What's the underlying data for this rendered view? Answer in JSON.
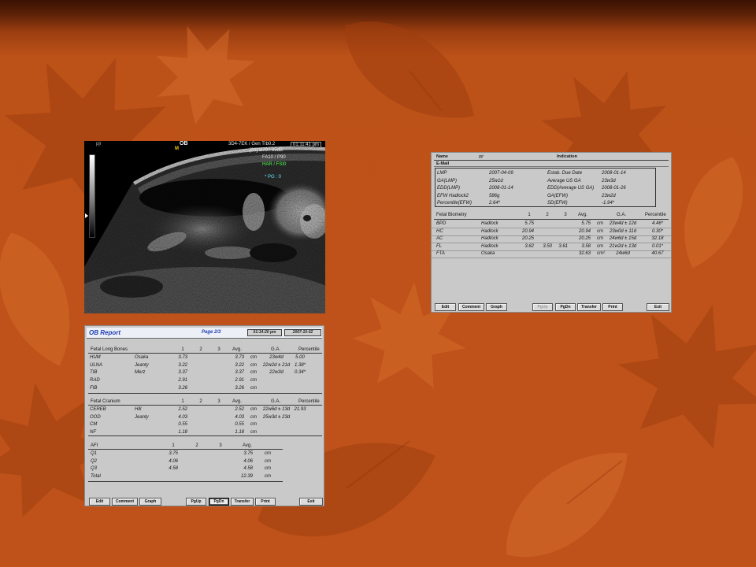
{
  "colors": {
    "slide_background": "#c0531a",
    "report_panel": "#c9c9c9",
    "report_title": "#1f3fb0",
    "harmonic_text": "#4cff4c",
    "pg_text": "#66e6ff",
    "marker": "#f0d000"
  },
  "ultrasound": {
    "patient": "pjr",
    "mode": "OB",
    "marker": "M",
    "probe": "3D4-7EK / Gen TIb0.2",
    "time": "01:11:41 pm",
    "gain": "[20] G70 / 95dB",
    "focus": "FA10 / P90",
    "harmonic": "HAR / FSI0",
    "pg": "* PG : 0"
  },
  "report1": {
    "name_label": "Name",
    "name_value": "pjr",
    "indication_label": "Indication",
    "email_label": "E-Mail",
    "summary": [
      {
        "label1": "LMP",
        "value1": "2007-04-09",
        "label2": "Estab. Due Date",
        "value2": "2008-01-14"
      },
      {
        "label1": "GA(LMP)",
        "value1": "25w1d",
        "label2": "Average US GA",
        "value2": "23w3d"
      },
      {
        "label1": "EDD(LMP)",
        "value1": "2008-01-14",
        "label2": "EDD(Average US GA)",
        "value2": "2008-01-26"
      },
      {
        "label1": "EFW Hadlock2",
        "value1": "586g",
        "label2": "GA(EFW)",
        "value2": "23w2d"
      },
      {
        "label1": "Percentile(EFW)",
        "value1": "2.64*",
        "label2": "SD(EFW)",
        "value2": "-1.94*"
      }
    ],
    "biometry": {
      "title": "Fetal Biometry",
      "col1": "1",
      "col2": "2",
      "col3": "3",
      "avg": "Avg.",
      "ga": "G.A.",
      "percentile": "Percentile",
      "rows": [
        {
          "name": "BPD",
          "method": "Hadlock",
          "m1": "5.75",
          "avg": "5.75",
          "unit": "cm",
          "ga": "23w4d ± 12d",
          "pct": "4.46*"
        },
        {
          "name": "HC",
          "method": "Hadlock",
          "m1": "20.94",
          "avg": "20.94",
          "unit": "cm",
          "ga": "23w0d ± 11d",
          "pct": "0.30*"
        },
        {
          "name": "AC",
          "method": "Hadlock",
          "m1": "20.25",
          "avg": "20.25",
          "unit": "cm",
          "ga": "24w6d ± 15d",
          "pct": "32.18"
        },
        {
          "name": "FL",
          "method": "Hadlock",
          "m1": "3.62",
          "m2": "3.50",
          "m3": "3.61",
          "avg": "3.58",
          "unit": "cm",
          "ga": "21w2d ± 13d",
          "pct": "0.01*"
        },
        {
          "name": "FTA",
          "method": "Osaka",
          "avg": "32.63",
          "unit": "cm²",
          "ga": "24w6d",
          "pct": "40.67"
        }
      ]
    },
    "buttons": [
      {
        "label": "Edit",
        "state": "normal"
      },
      {
        "label": "Comment",
        "state": "normal"
      },
      {
        "label": "Graph",
        "state": "normal"
      },
      {
        "label": "PgUp",
        "state": "disabled"
      },
      {
        "label": "PgDn",
        "state": "normal"
      },
      {
        "label": "Transfer",
        "state": "normal"
      },
      {
        "label": "Print",
        "state": "normal"
      },
      {
        "label": "Exit",
        "state": "normal"
      }
    ]
  },
  "report2": {
    "title": "OB Report",
    "page": "Page 2/3",
    "time": "01:14:20 pm",
    "date": "2007-10-02",
    "long_bones": {
      "title": "Fetal Long Bones",
      "col1": "1",
      "col2": "2",
      "col3": "3",
      "avg": "Avg.",
      "ga": "G.A.",
      "percentile": "Percentile",
      "rows": [
        {
          "name": "HUM",
          "method": "Osaka",
          "m1": "3.73",
          "avg": "3.73",
          "unit": "cm",
          "ga": "23w4d",
          "pct": "5.00"
        },
        {
          "name": "ULNA",
          "method": "Jeanty",
          "m1": "3.22",
          "avg": "3.22",
          "unit": "cm",
          "ga": "22w2d ± 21d",
          "pct": "1.38*"
        },
        {
          "name": "TIB",
          "method": "Merz",
          "m1": "3.37",
          "avg": "3.37",
          "unit": "cm",
          "ga": "22w3d",
          "pct": "0.34*"
        },
        {
          "name": "RAD",
          "m1": "2.91",
          "avg": "2.91",
          "unit": "cm"
        },
        {
          "name": "FIB",
          "m1": "3.26",
          "avg": "3.26",
          "unit": "cm"
        }
      ]
    },
    "cranium": {
      "title": "Fetal Cranium",
      "col1": "1",
      "col2": "2",
      "col3": "3",
      "avg": "Avg.",
      "ga": "G.A.",
      "percentile": "Percentile",
      "rows": [
        {
          "name": "CEREB",
          "method": "Hill",
          "m1": "2.52",
          "avg": "2.52",
          "unit": "cm",
          "ga": "22w6d ± 13d",
          "pct": "21.93"
        },
        {
          "name": "OOD",
          "method": "Jeanty",
          "m1": "4.03",
          "avg": "4.03",
          "unit": "cm",
          "ga": "25w3d ± 23d"
        },
        {
          "name": "CM",
          "m1": "0.55",
          "avg": "0.55",
          "unit": "cm"
        },
        {
          "name": "NF",
          "m1": "1.18",
          "avg": "1.18",
          "unit": "cm"
        }
      ]
    },
    "afi": {
      "title": "AFI",
      "col1": "1",
      "col2": "2",
      "col3": "3",
      "avg": "Avg.",
      "rows": [
        {
          "name": "Q1",
          "m1": "3.75",
          "avg": "3.75",
          "unit": "cm"
        },
        {
          "name": "Q2",
          "m1": "4.06",
          "avg": "4.06",
          "unit": "cm"
        },
        {
          "name": "Q3",
          "m1": "4.58",
          "avg": "4.58",
          "unit": "cm"
        },
        {
          "name": "Total",
          "avg": "12.39",
          "unit": "cm"
        }
      ]
    },
    "buttons": [
      {
        "label": "Edit",
        "state": "normal"
      },
      {
        "label": "Comment",
        "state": "normal"
      },
      {
        "label": "Graph",
        "state": "normal"
      },
      {
        "label": "PgUp",
        "state": "normal"
      },
      {
        "label": "PgDn",
        "state": "active"
      },
      {
        "label": "Transfer",
        "state": "normal"
      },
      {
        "label": "Print",
        "state": "normal"
      },
      {
        "label": "Exit",
        "state": "normal"
      }
    ]
  }
}
